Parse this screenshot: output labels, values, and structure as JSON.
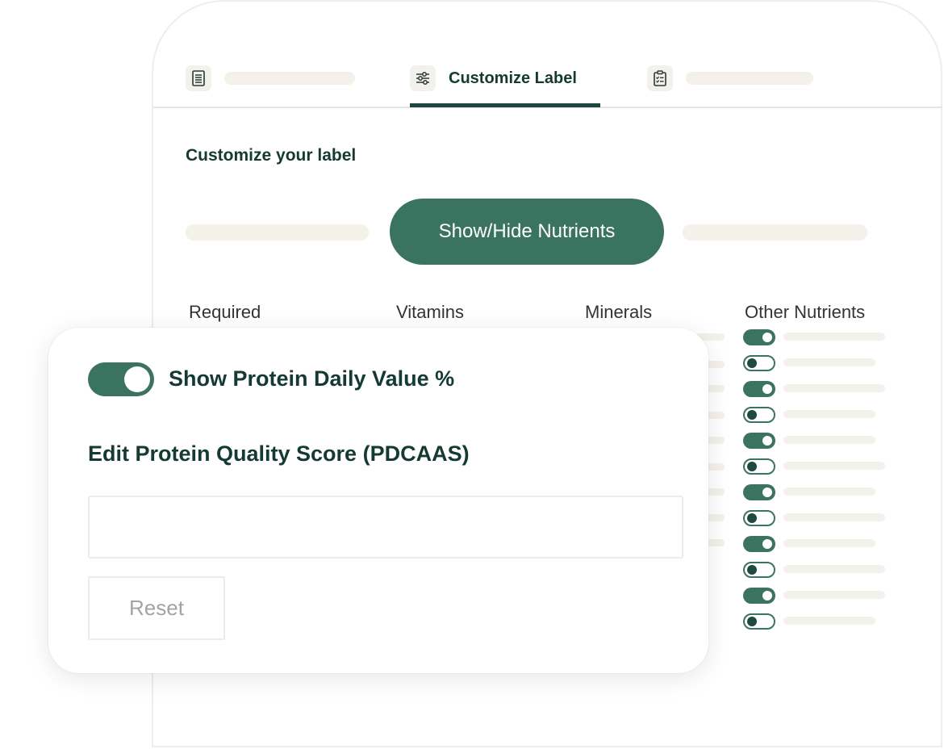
{
  "tabs": {
    "active_label": "Customize Label"
  },
  "panel": {
    "title": "Customize your label",
    "segment_active": "Show/Hide Nutrients",
    "columns": [
      "Required",
      "Vitamins",
      "Minerals",
      "Other Nutrients"
    ],
    "other_nutrient_toggles": [
      true,
      false,
      true,
      false,
      true,
      false,
      true,
      false,
      true,
      false,
      true,
      false
    ]
  },
  "card": {
    "toggle_label": "Show Protein Daily Value %",
    "toggle_on": true,
    "score_label": "Edit Protein Quality Score (PDCAAS)",
    "score_value": "",
    "reset_label": "Reset"
  },
  "colors": {
    "accent": "#3a7360",
    "heading": "#143a33",
    "placeholder_bar": "#f3f1ea"
  },
  "icons": {
    "tab1": "document-list-icon",
    "tab2": "sliders-icon",
    "tab3": "clipboard-checklist-icon"
  }
}
